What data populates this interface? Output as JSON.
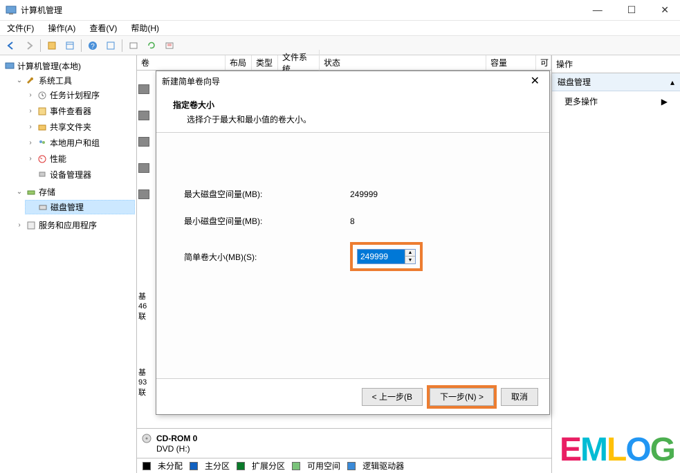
{
  "titlebar": {
    "title": "计算机管理"
  },
  "menubar": {
    "file": "文件(F)",
    "action": "操作(A)",
    "view": "查看(V)",
    "help": "帮助(H)"
  },
  "tree": {
    "root": "计算机管理(本地)",
    "system_tools": "系统工具",
    "task_scheduler": "任务计划程序",
    "event_viewer": "事件查看器",
    "shared_folders": "共享文件夹",
    "local_users": "本地用户和组",
    "performance": "性能",
    "device_manager": "设备管理器",
    "storage": "存储",
    "disk_management": "磁盘管理",
    "services_apps": "服务和应用程序"
  },
  "vol_header": {
    "volume": "卷",
    "layout": "布局",
    "type": "类型",
    "fs": "文件系统",
    "status": "状态",
    "capacity": "容量",
    "free": "可"
  },
  "behind": {
    "d1a": "基",
    "d1b": "46",
    "d1c": "联",
    "d2a": "基",
    "d2b": "93",
    "d2c": "联",
    "cd_label": "CD-ROM 0",
    "cd_sub": "DVD (H:)"
  },
  "legend": {
    "unallocated": "未分配",
    "primary": "主分区",
    "extended": "扩展分区",
    "free": "可用空间",
    "logical": "逻辑驱动器"
  },
  "actions": {
    "header": "操作",
    "group": "磁盘管理",
    "more": "更多操作"
  },
  "wizard": {
    "title": "新建简单卷向导",
    "heading": "指定卷大小",
    "subheading": "选择介于最大和最小值的卷大小。",
    "max_label": "最大磁盘空间量(MB):",
    "max_value": "249999",
    "min_label": "最小磁盘空间量(MB):",
    "min_value": "8",
    "size_label": "简单卷大小(MB)(S):",
    "size_value": "249999",
    "back": "< 上一步(B",
    "next": "下一步(N) >",
    "cancel": "取消"
  },
  "watermark": {
    "c1": "E",
    "c2": "M",
    "c3": "L",
    "c4": "O",
    "c5": "G"
  }
}
